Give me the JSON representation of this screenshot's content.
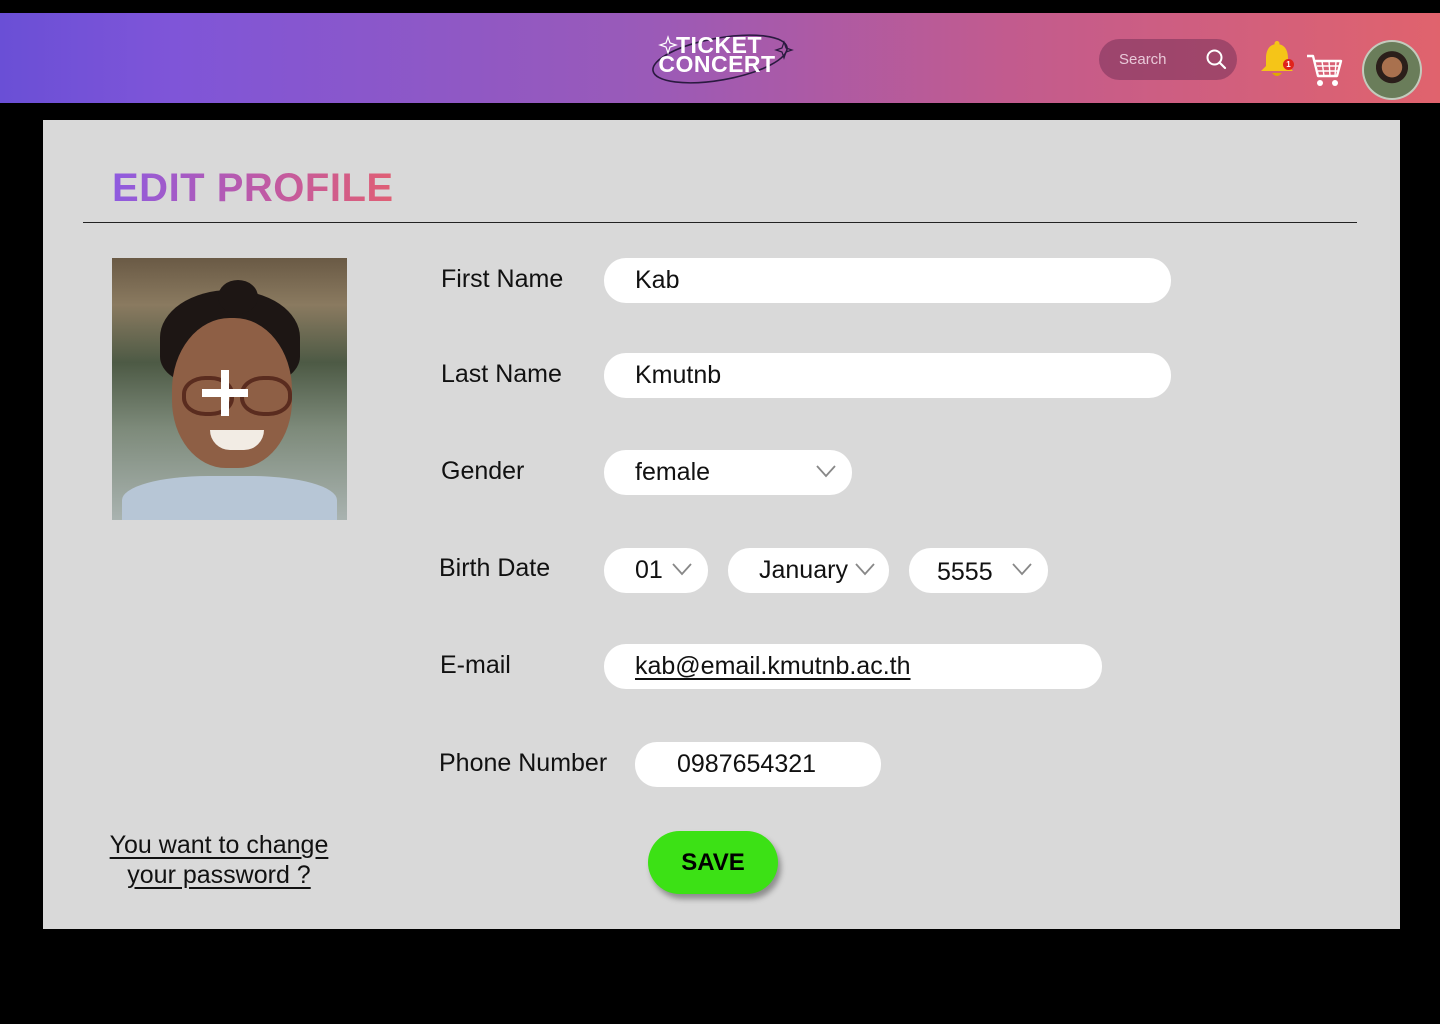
{
  "header": {
    "brand_line1": "TICKET",
    "brand_line2": "CONCERT",
    "search_placeholder": "Search",
    "notification_count": "1"
  },
  "page": {
    "title": "EDIT PROFILE"
  },
  "form": {
    "first_name": {
      "label": "First Name",
      "value": "Kab"
    },
    "last_name": {
      "label": "Last Name",
      "value": "Kmutnb"
    },
    "gender": {
      "label": "Gender",
      "value": "female"
    },
    "birth_date": {
      "label": "Birth Date",
      "day": "01",
      "month": "January",
      "year": "5555"
    },
    "email": {
      "label": "E-mail",
      "value": "kab@email.kmutnb.ac.th"
    },
    "phone": {
      "label": "Phone Number",
      "value": "0987654321"
    }
  },
  "actions": {
    "save_label": "SAVE",
    "change_password_line1": "You want to change",
    "change_password_line2": "your password ?"
  },
  "colors": {
    "save_button": "#3ce115",
    "panel_bg": "#d9d9d9",
    "header_start": "#6a4fd6",
    "header_end": "#e0636d"
  },
  "icons": [
    "search-icon",
    "bell-icon",
    "cart-icon",
    "chevron-down-icon",
    "plus-icon"
  ]
}
